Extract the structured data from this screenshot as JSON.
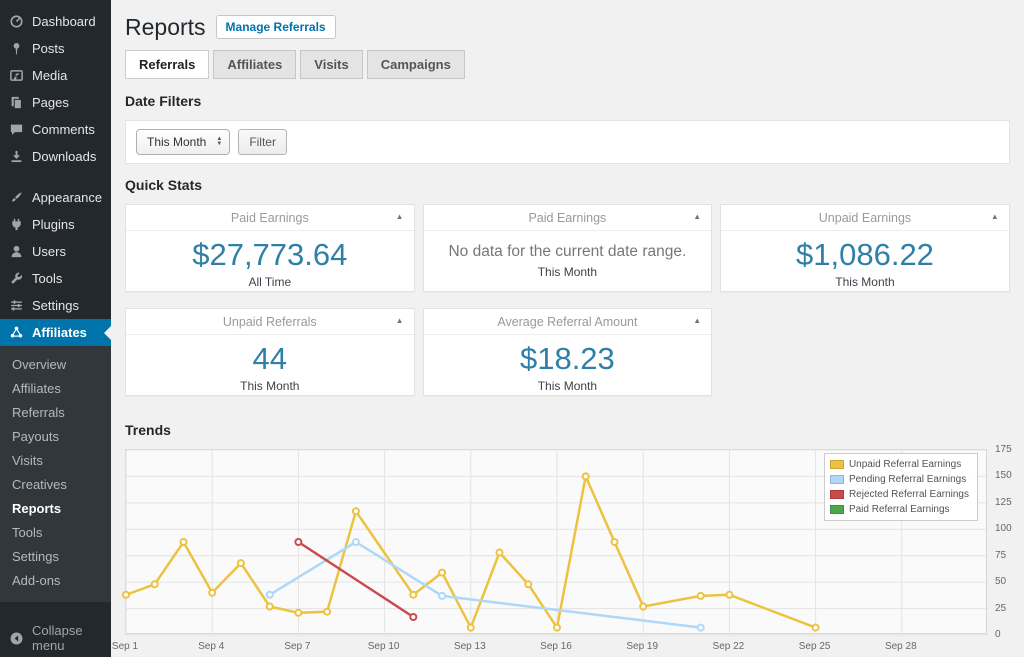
{
  "sidebar": {
    "items": [
      {
        "label": "Dashboard",
        "icon": "dashboard-icon",
        "group": 1,
        "active": false
      },
      {
        "label": "Posts",
        "icon": "posts-icon",
        "group": 1,
        "active": false
      },
      {
        "label": "Media",
        "icon": "media-icon",
        "group": 1,
        "active": false
      },
      {
        "label": "Pages",
        "icon": "pages-icon",
        "group": 1,
        "active": false
      },
      {
        "label": "Comments",
        "icon": "comments-icon",
        "group": 1,
        "active": false
      },
      {
        "label": "Downloads",
        "icon": "downloads-icon",
        "group": 1,
        "active": false
      },
      {
        "label": "Appearance",
        "icon": "appearance-icon",
        "group": 2,
        "active": false
      },
      {
        "label": "Plugins",
        "icon": "plugins-icon",
        "group": 2,
        "active": false
      },
      {
        "label": "Users",
        "icon": "users-icon",
        "group": 2,
        "active": false
      },
      {
        "label": "Tools",
        "icon": "tools-icon",
        "group": 2,
        "active": false
      },
      {
        "label": "Settings",
        "icon": "settings-icon",
        "group": 2,
        "active": false
      },
      {
        "label": "Affiliates",
        "icon": "affiliates-icon",
        "group": 2,
        "active": true
      }
    ],
    "submenu": {
      "items": [
        "Overview",
        "Affiliates",
        "Referrals",
        "Payouts",
        "Visits",
        "Creatives",
        "Reports",
        "Tools",
        "Settings",
        "Add-ons"
      ],
      "active": "Reports"
    },
    "collapse": {
      "label": "Collapse menu",
      "icon": "collapse-icon"
    },
    "colors": {
      "background": "#23282d",
      "submenu_background": "#32373c",
      "active_background": "#0073aa"
    }
  },
  "header": {
    "title": "Reports",
    "action": "Manage Referrals"
  },
  "tabs": {
    "items": [
      "Referrals",
      "Affiliates",
      "Visits",
      "Campaigns"
    ],
    "active": "Referrals"
  },
  "date_filters": {
    "heading": "Date Filters",
    "select_value": "This Month",
    "filter_button": "Filter"
  },
  "quick_stats": {
    "heading": "Quick Stats",
    "value_color": "#2f7fa7",
    "cards": [
      {
        "title": "Paid Earnings",
        "value": "$27,773.64",
        "period": "All Time"
      },
      {
        "title": "Paid Earnings",
        "message": "No data for the current date range.",
        "period": "This Month"
      },
      {
        "title": "Unpaid Earnings",
        "value": "$1,086.22",
        "period": "This Month"
      },
      {
        "title": "Unpaid Referrals",
        "value": "44",
        "period": "This Month"
      },
      {
        "title": "Average Referral Amount",
        "value": "$18.23",
        "period": "This Month"
      }
    ]
  },
  "trends": {
    "heading": "Trends"
  },
  "chart_data": {
    "type": "line",
    "title": "Trends",
    "grid": true,
    "legend_position": "top-right",
    "x_axis": {
      "labels": [
        "Sep 1",
        "Sep 4",
        "Sep 7",
        "Sep 10",
        "Sep 13",
        "Sep 16",
        "Sep 19",
        "Sep 22",
        "Sep 25",
        "Sep 28"
      ],
      "label_days": [
        1,
        4,
        7,
        10,
        13,
        16,
        19,
        22,
        25,
        28
      ],
      "domain": [
        1,
        31
      ]
    },
    "y_axis": {
      "ticks": [
        0,
        25,
        50,
        75,
        100,
        125,
        150,
        175
      ],
      "range": [
        0,
        175
      ],
      "position": "right"
    },
    "series": [
      {
        "name": "Unpaid Referral Earnings",
        "color": "#edc240",
        "points": [
          [
            1,
            38
          ],
          [
            2,
            48
          ],
          [
            3,
            88
          ],
          [
            4,
            40
          ],
          [
            5,
            68
          ],
          [
            6,
            27
          ],
          [
            7,
            21
          ],
          [
            8,
            22
          ],
          [
            9,
            117
          ],
          [
            11,
            38
          ],
          [
            12,
            59
          ],
          [
            13,
            7
          ],
          [
            14,
            78
          ],
          [
            15,
            48
          ],
          [
            16,
            7
          ],
          [
            17,
            150
          ],
          [
            18,
            88
          ],
          [
            19,
            27
          ],
          [
            21,
            37
          ],
          [
            22,
            38
          ],
          [
            25,
            7
          ]
        ]
      },
      {
        "name": "Pending Referral Earnings",
        "color": "#afd8f8",
        "points": [
          [
            6,
            38
          ],
          [
            9,
            88
          ],
          [
            12,
            37
          ],
          [
            21,
            7
          ]
        ]
      },
      {
        "name": "Rejected Referral Earnings",
        "color": "#cb4b4b",
        "points": [
          [
            7,
            88
          ],
          [
            11,
            17
          ]
        ]
      },
      {
        "name": "Paid Referral Earnings",
        "color": "#4da74d",
        "points": []
      }
    ]
  }
}
